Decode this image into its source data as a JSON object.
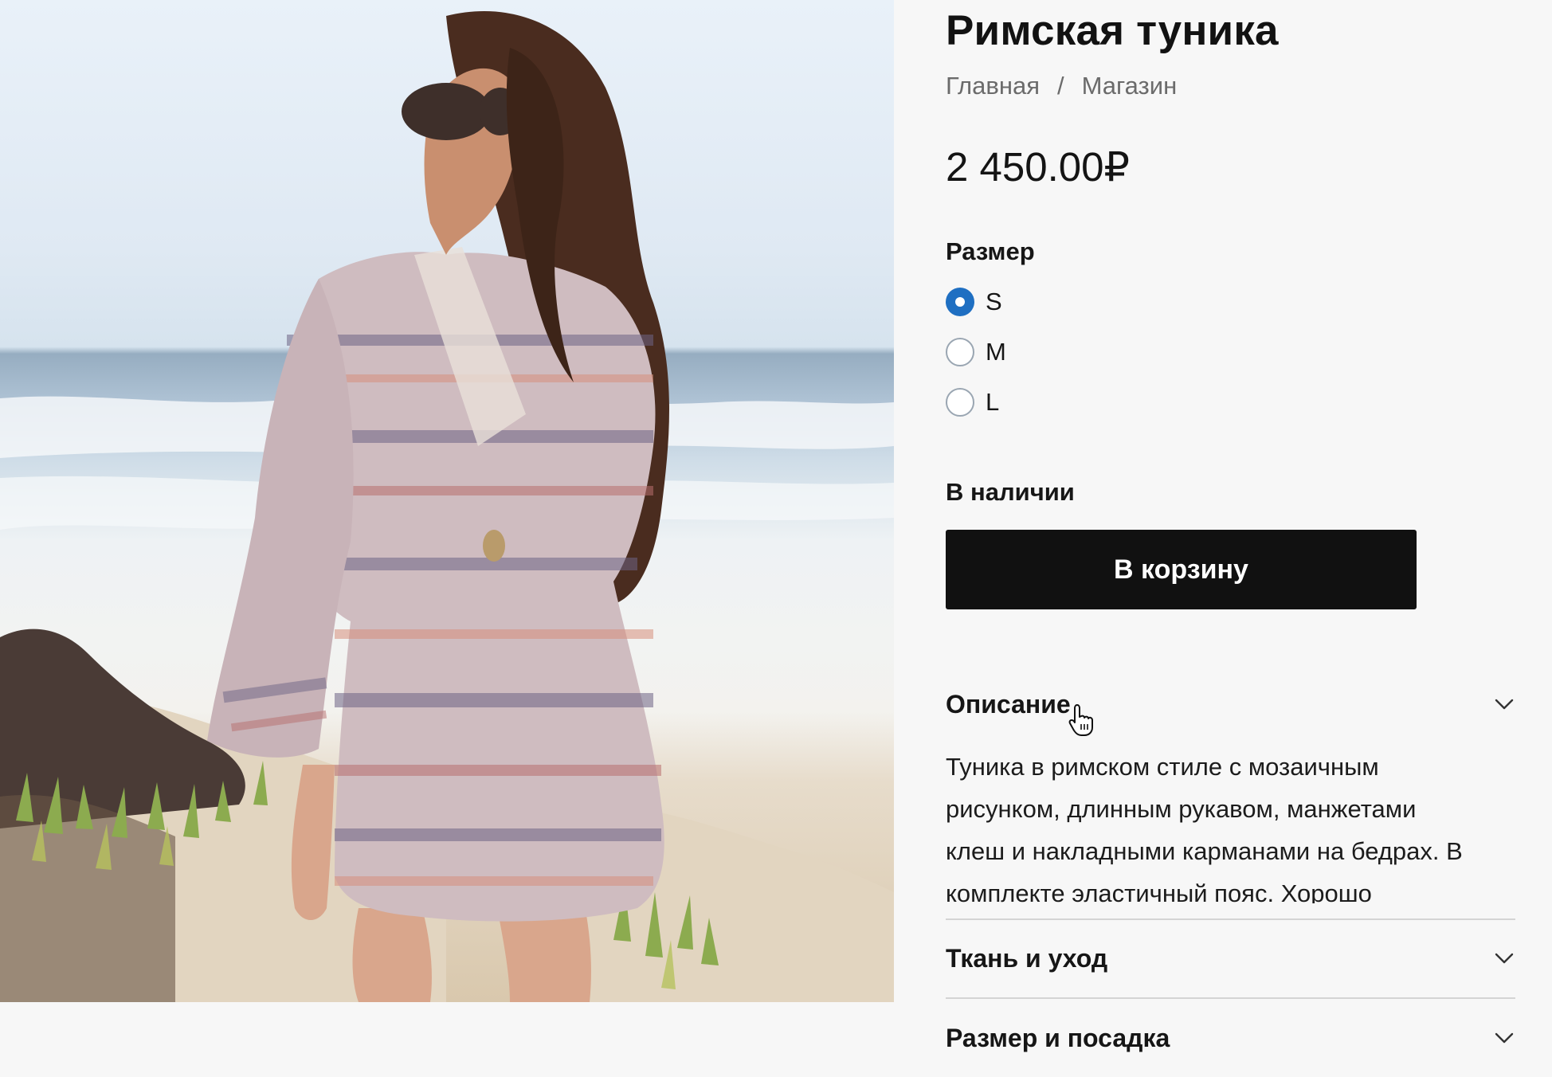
{
  "product": {
    "image_alt": "Женщина в тунике с мозаичным принтом на берегу моря",
    "title": "Римская туника",
    "price": "2 450.00₽"
  },
  "breadcrumb": {
    "home": "Главная",
    "separator": "/",
    "shop": "Магазин"
  },
  "size": {
    "label": "Размер",
    "options": [
      {
        "label": "S",
        "selected": true
      },
      {
        "label": "M",
        "selected": false
      },
      {
        "label": "L",
        "selected": false
      }
    ]
  },
  "availability": "В наличии",
  "cart_button": "В корзину",
  "accordion": {
    "description": {
      "title": "Описание",
      "expanded": true,
      "lines": [
        "Туника в римском стиле с мозаичным",
        "рисунком, длинным рукавом, манжетами",
        "клеш и накладными карманами на бедрах. В",
        "комплекте эластичный пояс. Хорошо"
      ]
    },
    "fabric": {
      "title": "Ткань и уход",
      "expanded": false
    },
    "fit": {
      "title": "Размер и посадка",
      "expanded": false
    }
  },
  "colors": {
    "accent": "#1f6fc2",
    "button_bg": "#111111",
    "page_bg": "#f7f7f7"
  },
  "icons": {
    "chevron": "chevron-down-icon",
    "cursor": "pointer-hand-icon"
  }
}
